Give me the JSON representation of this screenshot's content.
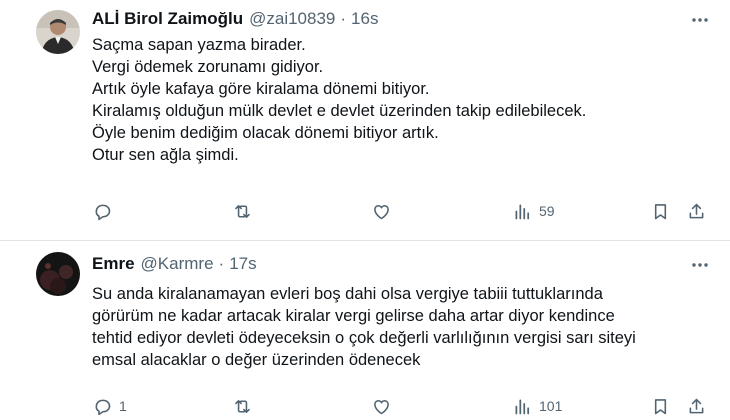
{
  "tweets": [
    {
      "author_name": "ALİ Birol Zaimoğlu",
      "handle": "@zai10839",
      "separator": "·",
      "time": "16s",
      "lines": [
        "Saçma sapan yazma birader.",
        "Vergi ödemek zorunamı gidiyor.",
        "Artık öyle kafaya göre kiralama dönemi bitiyor.",
        "Kiralamış olduğun mülk devlet e devlet üzerinden takip edilebilecek.",
        "Öyle benim dediğim olacak dönemi bitiyor artık.",
        "Otur sen ağla şimdi."
      ],
      "replies": "",
      "retweets": "",
      "likes": "",
      "views": "59",
      "avatar_icon": "avatar-photo-man-in-suit"
    },
    {
      "author_name": "Emre",
      "handle": "@Karmre",
      "separator": "·",
      "time": "17s",
      "lines": [
        "Su anda kiralanamayan evleri boş dahi olsa vergiye tabiii tuttuklarında",
        "görürüm ne kadar artacak kiralar  vergi gelirse daha artar diyor kendince",
        "tehtid ediyor devleti ödeyeceksin o çok değerli varlılığının vergisi sarı siteyi",
        "emsal alacaklar o değer üzerinden ödenecek"
      ],
      "replies": "1",
      "retweets": "",
      "likes": "",
      "views": "101",
      "avatar_icon": "avatar-photo-dark-night"
    }
  ],
  "colors": {
    "text": "#0f1419",
    "secondary": "#536471",
    "divider": "#e1e5e8"
  }
}
